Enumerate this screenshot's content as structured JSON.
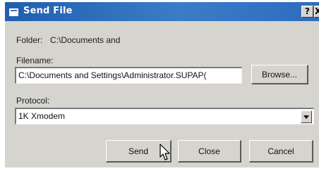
{
  "window": {
    "title": "Send File",
    "help_glyph": "?",
    "close_glyph": "X"
  },
  "folder": {
    "label": "Folder:",
    "value": "C:\\Documents and"
  },
  "filename": {
    "label": "Filename:",
    "value": "C:\\Documents and Settings\\Administrator.SUPAP(",
    "browse_label": "Browse..."
  },
  "protocol": {
    "label": "Protocol:",
    "selected": "1K Xmodem"
  },
  "buttons": {
    "send": "Send",
    "close": "Close",
    "cancel": "Cancel"
  },
  "icons": {
    "title_icon": "window-icon",
    "cursor": "mouse-pointer-icon"
  }
}
